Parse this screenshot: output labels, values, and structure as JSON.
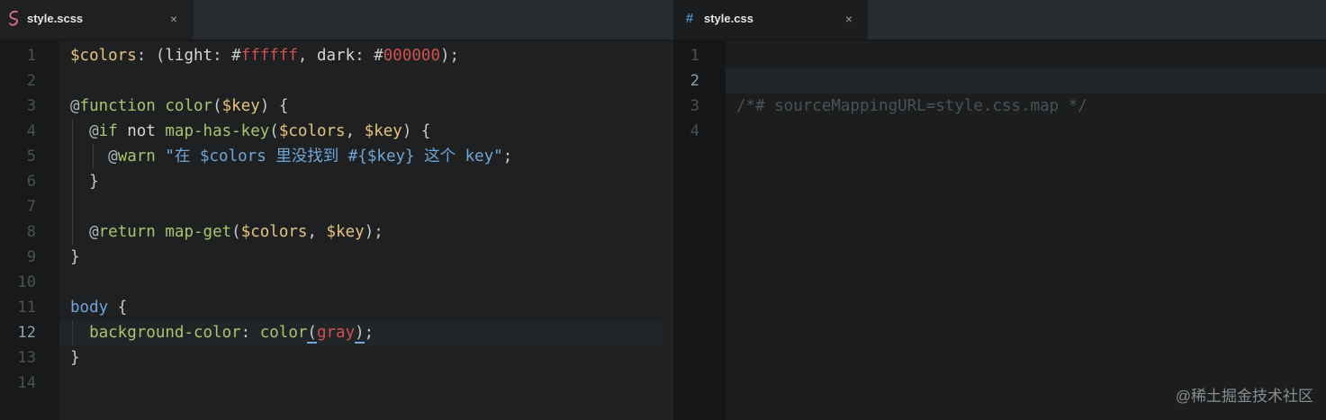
{
  "left_tab": {
    "icon": "sass-icon",
    "title": "style.scss",
    "close": "×"
  },
  "right_tab": {
    "icon": "hash-icon",
    "title": "style.css",
    "close": "×"
  },
  "left_editor": {
    "active_line": 12,
    "line_numbers": [
      "1",
      "2",
      "3",
      "4",
      "5",
      "6",
      "7",
      "8",
      "9",
      "10",
      "11",
      "12",
      "13",
      "14"
    ],
    "lines": [
      [
        [
          "c-var",
          "$colors"
        ],
        [
          "c-punc",
          ": ("
        ],
        [
          "c-plain",
          "light"
        ],
        [
          "c-punc",
          ": "
        ],
        [
          "c-punc",
          "#"
        ],
        [
          "c-hex",
          "ffffff"
        ],
        [
          "c-punc",
          ", "
        ],
        [
          "c-plain",
          "dark"
        ],
        [
          "c-punc",
          ": "
        ],
        [
          "c-punc",
          "#"
        ],
        [
          "c-hex",
          "000000"
        ],
        [
          "c-punc",
          ");"
        ]
      ],
      [],
      [
        [
          "c-at",
          "@"
        ],
        [
          "c-kw",
          "function"
        ],
        [
          "c-plain",
          " "
        ],
        [
          "c-fn",
          "color"
        ],
        [
          "c-punc",
          "("
        ],
        [
          "c-var",
          "$key"
        ],
        [
          "c-punc",
          ") {"
        ]
      ],
      [
        [
          "c-plain",
          "  "
        ],
        [
          "c-at",
          "@"
        ],
        [
          "c-kw",
          "if"
        ],
        [
          "c-plain",
          " not "
        ],
        [
          "c-fn",
          "map-has-key"
        ],
        [
          "c-punc",
          "("
        ],
        [
          "c-var",
          "$colors"
        ],
        [
          "c-punc",
          ", "
        ],
        [
          "c-var",
          "$key"
        ],
        [
          "c-punc",
          ") {"
        ]
      ],
      [
        [
          "c-plain",
          "    "
        ],
        [
          "c-at",
          "@"
        ],
        [
          "c-kw",
          "warn"
        ],
        [
          "c-plain",
          " "
        ],
        [
          "c-str",
          "\"在 $colors 里没找到 #{$key} 这个 key\""
        ],
        [
          "c-punc",
          ";"
        ]
      ],
      [
        [
          "c-plain",
          "  "
        ],
        [
          "c-punc",
          "}"
        ]
      ],
      [],
      [
        [
          "c-plain",
          "  "
        ],
        [
          "c-at",
          "@"
        ],
        [
          "c-kw",
          "return"
        ],
        [
          "c-plain",
          " "
        ],
        [
          "c-fn",
          "map-get"
        ],
        [
          "c-punc",
          "("
        ],
        [
          "c-var",
          "$colors"
        ],
        [
          "c-punc",
          ", "
        ],
        [
          "c-var",
          "$key"
        ],
        [
          "c-punc",
          ");"
        ]
      ],
      [
        [
          "c-punc",
          "}"
        ]
      ],
      [],
      [
        [
          "c-sel",
          "body"
        ],
        [
          "c-punc",
          " {"
        ]
      ],
      [
        [
          "c-plain",
          "  "
        ],
        [
          "c-prop",
          "background-color"
        ],
        [
          "c-punc",
          ": "
        ],
        [
          "c-fn",
          "color"
        ],
        [
          "c-punc paren-mark",
          "("
        ],
        [
          "c-val",
          "gray"
        ],
        [
          "c-punc paren-mark",
          ")"
        ],
        [
          "c-punc",
          ";"
        ]
      ],
      [
        [
          "c-punc",
          "}"
        ]
      ],
      []
    ]
  },
  "right_editor": {
    "active_line": 2,
    "line_numbers": [
      "1",
      "2",
      "3",
      "4"
    ],
    "lines": [
      [],
      [],
      [
        [
          "c-comment",
          "/*# sourceMappingURL=style.css.map */"
        ]
      ],
      []
    ]
  },
  "watermark": "@稀土掘金技术社区"
}
